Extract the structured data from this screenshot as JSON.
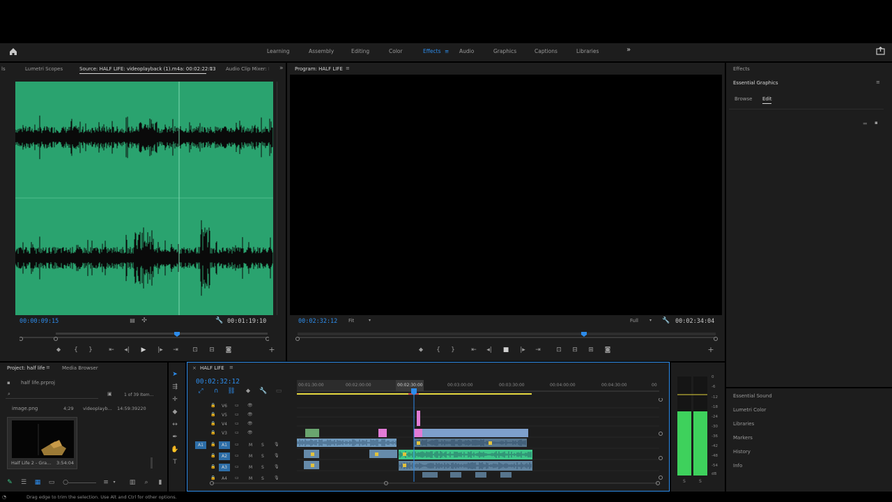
{
  "workspaces": {
    "items": [
      "Learning",
      "Assembly",
      "Editing",
      "Color",
      "Effects",
      "Audio",
      "Graphics",
      "Captions",
      "Libraries"
    ],
    "active": "Effects",
    "more_icon": "double-chevron-right-icon"
  },
  "source_panel": {
    "tabs": [
      "ls",
      "Lumetri Scopes",
      "Source: HALF LIFE: videoplayback (1).m4a: 00:02:22:13",
      "Audio Clip Mixer: H"
    ],
    "active_tab": "Source: HALF LIFE: videoplayback (1).m4a: 00:02:22:13",
    "timecode_left": "00:00:09:15",
    "timecode_right": "00:01:19:10",
    "waveform_color": "#2aa36f"
  },
  "program_panel": {
    "tab": "Program: HALF LIFE",
    "timecode_left": "00:02:32:12",
    "fit": "Fit",
    "quality": "Full",
    "timecode_right": "00:02:34:04"
  },
  "essential_graphics": {
    "header": "Effects",
    "title": "Essential Graphics",
    "tabs": [
      "Browse",
      "Edit"
    ],
    "active_tab": "Edit"
  },
  "right_bottom_list": [
    "Essential Sound",
    "Lumetri Color",
    "Libraries",
    "Markers",
    "History",
    "Info"
  ],
  "project_panel": {
    "tabs": [
      "Project: half life",
      "Media Browser"
    ],
    "file": "half life.prproj",
    "count": "1 of 39 Item...",
    "items": [
      {
        "name": "image.png",
        "duration": "4;29",
        "extra": "videoplayb...",
        "time": "14:59:39220"
      }
    ],
    "thumb": {
      "name": "Half Life 2 - Gra...",
      "duration": "3:54:04"
    }
  },
  "timeline": {
    "sequence": "HALF LIFE",
    "timecode": "00:02:32:12",
    "ruler": [
      "00:01:30:00",
      "00:02:00:00",
      "00:02:30:00",
      "00:03:00:00",
      "00:03:30:00",
      "00:04:00:00",
      "00:04:30:00",
      "00"
    ],
    "video_tracks": [
      "V6",
      "V5",
      "V4",
      "V3"
    ],
    "audio_tracks": [
      "A1",
      "A2",
      "A3",
      "A4"
    ],
    "audio_track_source": "A1",
    "audio_labels": [
      "M",
      "S"
    ]
  },
  "meter": {
    "scale": [
      "0",
      "-6",
      "-12",
      "-18",
      "-24",
      "-30",
      "-36",
      "-42",
      "-48",
      "-54",
      "dB"
    ],
    "solo": [
      "S",
      "S"
    ]
  },
  "status_bar": "Drag edge to trim the selection. Use Alt and Ctrl for other options.",
  "colors": {
    "accent": "#2d8ceb",
    "audio_clip": "#7fb0d9",
    "green_clip": "#3ec98a",
    "pink_clip": "#e27bd6",
    "video_clip": "#7ea0cc",
    "meter_green": "#3ed15c"
  }
}
